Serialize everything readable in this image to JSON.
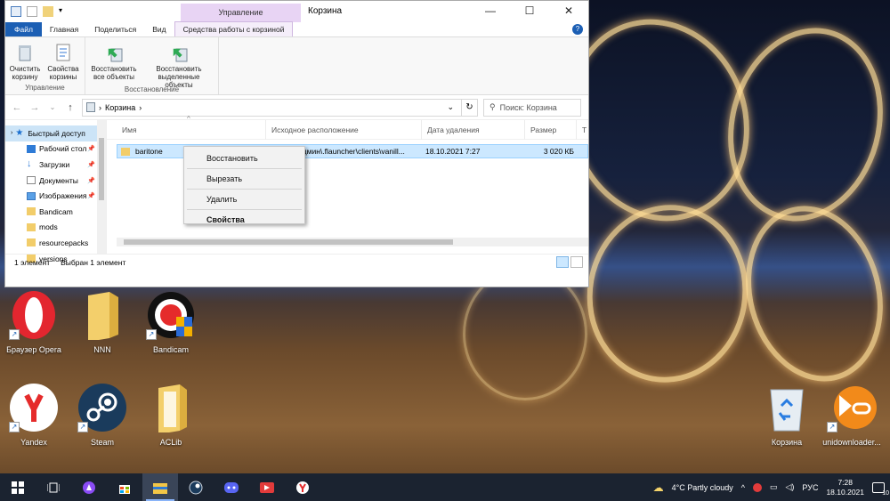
{
  "window": {
    "title": "Корзина",
    "context_group": "Управление",
    "buttons": {
      "minimize": "—",
      "maximize": "☐",
      "close": "✕"
    }
  },
  "ribbon": {
    "tabs": [
      "Файл",
      "Главная",
      "Поделиться",
      "Вид"
    ],
    "context_tab": "Средства работы с корзиной",
    "groups": [
      {
        "label": "Управление",
        "buttons": [
          "Очистить корзину",
          "Свойства корзины"
        ]
      },
      {
        "label": "Восстановление",
        "buttons": [
          "Восстановить все объекты",
          "Восстановить выделенные объекты"
        ]
      }
    ]
  },
  "address": {
    "path": "Корзина",
    "search_placeholder": "Поиск: Корзина"
  },
  "nav": {
    "quick_access": "Быстрый доступ",
    "items": [
      {
        "label": "Рабочий стол",
        "pinned": true
      },
      {
        "label": "Загрузки",
        "pinned": true
      },
      {
        "label": "Документы",
        "pinned": true
      },
      {
        "label": "Изображения",
        "pinned": true
      },
      {
        "label": "Bandicam",
        "pinned": false
      },
      {
        "label": "mods",
        "pinned": false
      },
      {
        "label": "resourcepacks",
        "pinned": false
      },
      {
        "label": "versions",
        "pinned": false
      }
    ]
  },
  "table": {
    "columns": [
      "Имя",
      "Исходное расположение",
      "Дата удаления",
      "Размер",
      "Т"
    ],
    "rows": [
      {
        "name": "baritone",
        "location": "Админ\\.flauncher\\clients\\vanill...",
        "date": "18.10.2021 7:27",
        "size": "3 020 КБ"
      }
    ]
  },
  "status": {
    "count": "1 элемент",
    "selected": "Выбран 1 элемент"
  },
  "context_menu": [
    "Восстановить",
    "Вырезать",
    "Удалить",
    "Свойства"
  ],
  "desktop": [
    {
      "label": "Браузер Opera",
      "icon": "opera-icon"
    },
    {
      "label": "NNN",
      "icon": "folder-icon"
    },
    {
      "label": "Bandicam",
      "icon": "bandicam-icon"
    },
    {
      "label": "Yandex",
      "icon": "yandex-icon"
    },
    {
      "label": "Steam",
      "icon": "steam-icon"
    },
    {
      "label": "ACLib",
      "icon": "folder-icon"
    },
    {
      "label": "Корзина",
      "icon": "recycle-bin-icon"
    },
    {
      "label": "unidownloader...",
      "icon": "unidownloader-icon"
    }
  ],
  "taskbar": {
    "weather": "4°C  Partly cloudy",
    "language": "РУС",
    "time": "7:28",
    "date": "18.10.2021",
    "notifications": "10"
  }
}
